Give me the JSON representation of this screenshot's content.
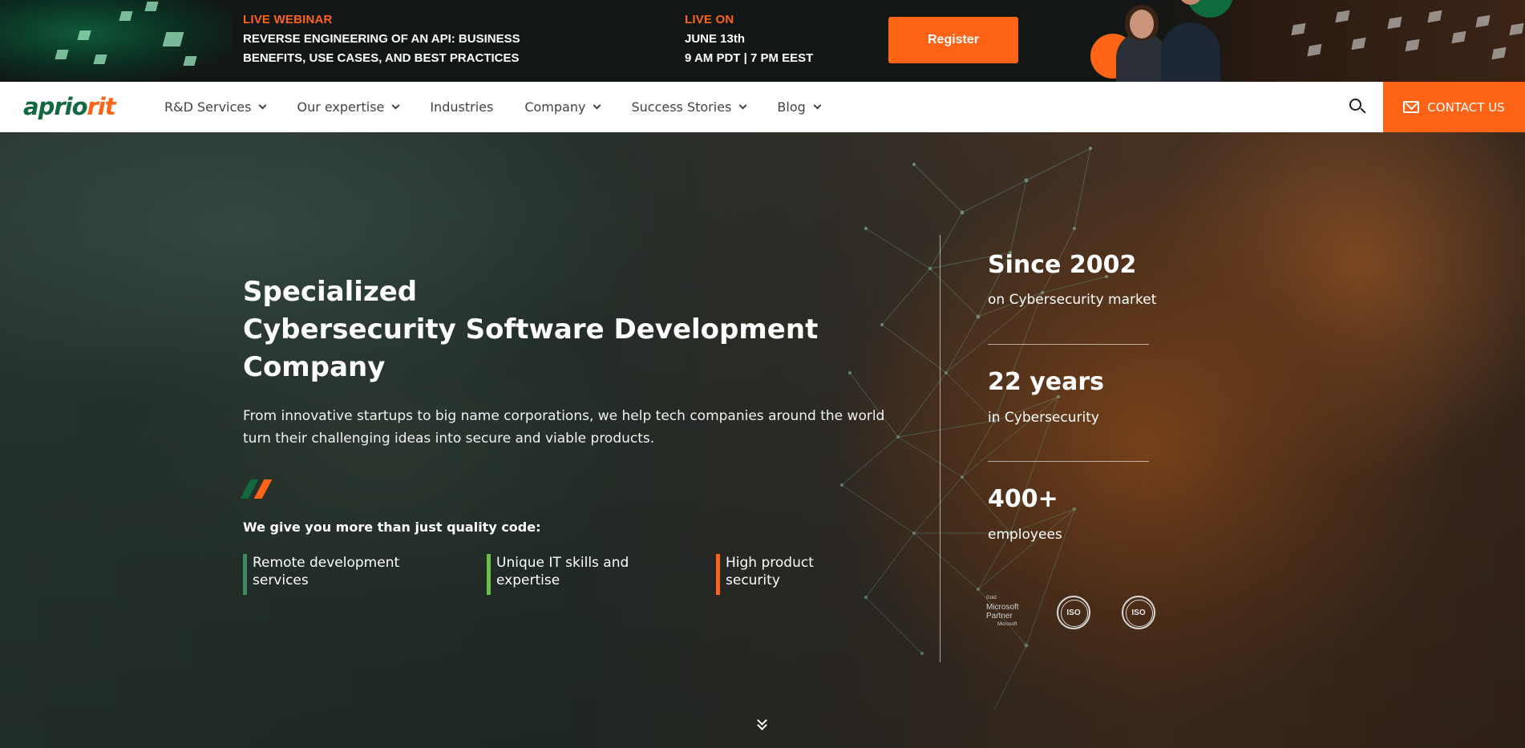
{
  "banner": {
    "label_webinar": "LIVE WEBINAR",
    "title_line1": "REVERSE ENGINEERING OF AN API: BUSINESS",
    "title_line2": "BENEFITS, USE CASES, AND BEST PRACTICES",
    "label_live": "LIVE ON",
    "date": "JUNE 13th",
    "time": "9 AM PDT | 7 PM EEST",
    "register_label": "Register"
  },
  "nav": {
    "logo_part1": "aprio",
    "logo_part2": "rit",
    "items": [
      {
        "label": "R&D Services",
        "has_dropdown": true
      },
      {
        "label": "Our expertise",
        "has_dropdown": true
      },
      {
        "label": "Industries",
        "has_dropdown": false
      },
      {
        "label": "Company",
        "has_dropdown": true
      },
      {
        "label": "Success Stories",
        "has_dropdown": true
      },
      {
        "label": "Blog",
        "has_dropdown": true
      }
    ],
    "contact_label": "CONTACT US"
  },
  "hero": {
    "title_line1": "Specialized",
    "title_line2": "Cybersecurity Software Development",
    "title_line3": "Company",
    "description": "From innovative startups to big name corporations, we help tech companies around the world turn their challenging ideas into secure and viable products.",
    "subheading": "We give you more than just quality code:",
    "features": [
      {
        "line1": "Remote development",
        "line2": "services",
        "color": "#3d8a5c"
      },
      {
        "line1": "Unique IT skills and",
        "line2": "expertise",
        "color": "#6cc04a"
      },
      {
        "line1": "High product",
        "line2": "security",
        "color": "#ff6315"
      }
    ],
    "stats": [
      {
        "value": "Since 2002",
        "caption": "on Cybersecurity market"
      },
      {
        "value": "22 years",
        "caption": "in Cybersecurity"
      },
      {
        "value": "400+",
        "caption": "employees"
      }
    ],
    "certs": {
      "ms_gold": "Gold",
      "ms_line1": "Microsoft",
      "ms_line2": "Partner",
      "ms_brand": "Microsoft",
      "iso1": "ISO",
      "iso2": "ISO"
    }
  },
  "colors": {
    "accent": "#ff6315",
    "brand_green": "#12683f"
  },
  "icons": {
    "search": "search-icon",
    "mail": "mail-icon",
    "chevron": "chevron-down-icon",
    "scroll": "double-chevron-down-icon"
  }
}
